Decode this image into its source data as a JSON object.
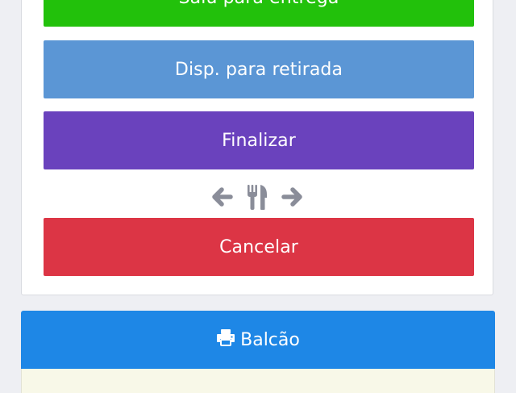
{
  "actions": {
    "delivery": {
      "label": "Saiu para entrega",
      "color": "#22c10b"
    },
    "pickup": {
      "label": "Disp. para retirada",
      "color": "#5b96d5"
    },
    "finalize": {
      "label": "Finalizar",
      "color": "#6a42bd"
    },
    "cancel": {
      "label": "Cancelar",
      "color": "#dc3545"
    }
  },
  "nav": {
    "icons": [
      "arrow-left-icon",
      "fork-knife-icon",
      "arrow-right-icon"
    ],
    "icon_color": "#8a8d99"
  },
  "print": {
    "label": "Balcão",
    "icon": "printer-icon",
    "color": "#1e87e6"
  },
  "note_color": "#f8f8e8"
}
